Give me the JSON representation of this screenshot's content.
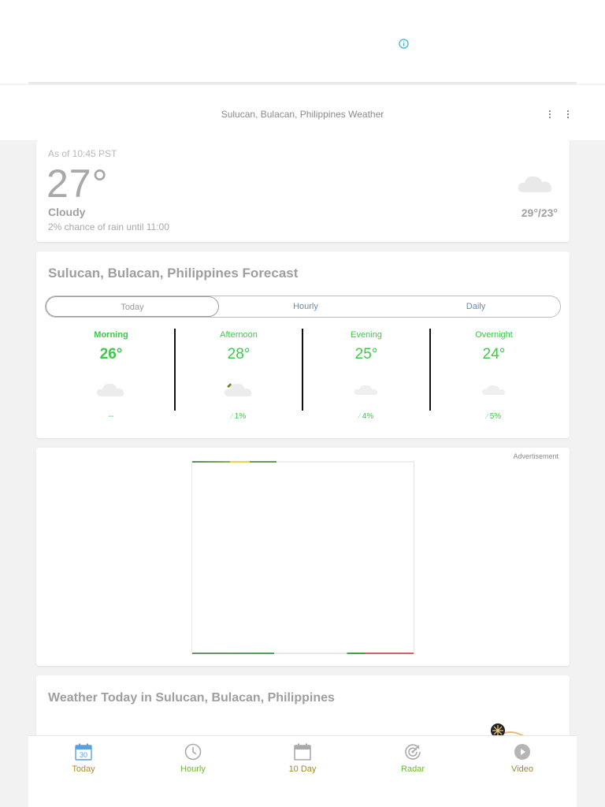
{
  "header": {
    "title": "Sulucan, Bulacan, Philippines Weather"
  },
  "current": {
    "as_of": "As of 10:45 PST",
    "temperature": "27°",
    "phrase": "Cloudy",
    "rain_text": "2% chance of rain until 11:00",
    "hi_lo": "29°/23°",
    "icon": "cloud-icon"
  },
  "forecast": {
    "title": "Sulucan, Bulacan, Philippines Forecast",
    "tabs": [
      {
        "label": "Today"
      },
      {
        "label": "Hourly"
      },
      {
        "label": "Daily"
      }
    ],
    "periods": [
      {
        "name": "Morning",
        "temp": "26°",
        "precip": "--",
        "icon": "cloud-icon"
      },
      {
        "name": "Afternoon",
        "temp": "28°",
        "precip": "1%",
        "icon": "partly-cloudy-icon"
      },
      {
        "name": "Evening",
        "temp": "25°",
        "precip": "4%",
        "icon": "cloud-icon"
      },
      {
        "name": "Overnight",
        "temp": "24°",
        "precip": "5%",
        "icon": "cloud-icon"
      }
    ],
    "accent_color": "#3ec74a"
  },
  "ad": {
    "label": "Advertisement"
  },
  "today_section": {
    "title": "Weather Today in Sulucan, Bulacan, Philippines"
  },
  "bottom_nav": [
    {
      "label": "Today",
      "day_number": "30",
      "icon": "calendar-today-icon"
    },
    {
      "label": "Hourly",
      "icon": "clock-icon"
    },
    {
      "label": "10 Day",
      "icon": "calendar-icon"
    },
    {
      "label": "Radar",
      "icon": "radar-icon"
    },
    {
      "label": "Video",
      "icon": "play-icon"
    }
  ]
}
